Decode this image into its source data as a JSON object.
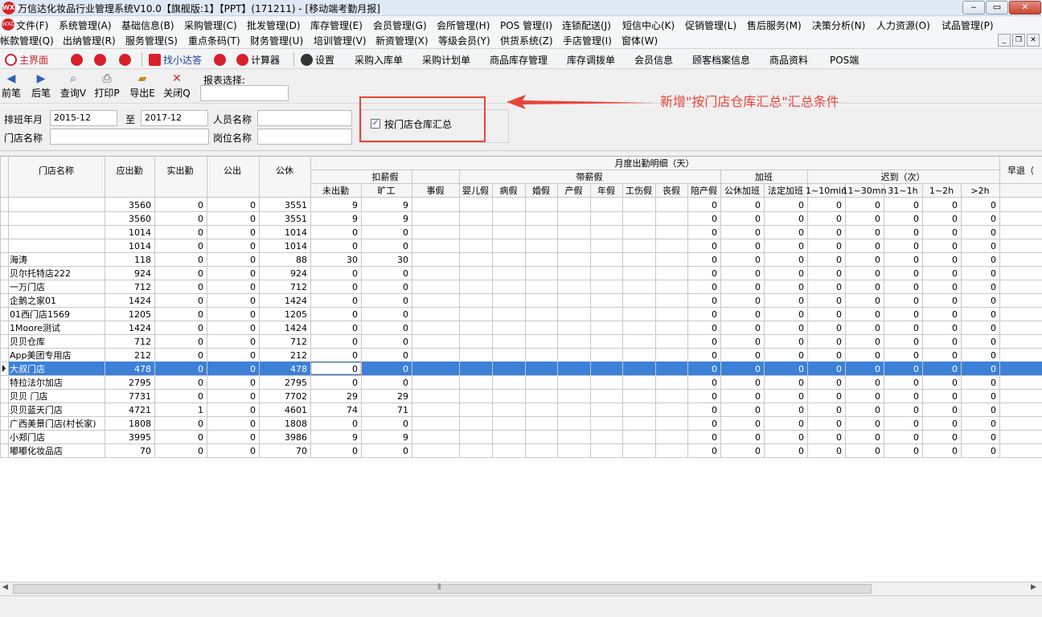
{
  "window": {
    "title": "万信达化妆品行业管理系统V10.0【旗舰版:1】【PPT】(171211) - [移动端考勤月报]",
    "logo_text": "WXD",
    "minimize": "‒",
    "maximize": "▭",
    "close": "✕"
  },
  "menu1": [
    "文件(F)",
    "系统管理(A)",
    "基础信息(B)",
    "采购管理(C)",
    "批发管理(D)",
    "库存管理(E)",
    "会员管理(G)",
    "会所管理(H)",
    "POS 管理(I)",
    "连锁配送(J)",
    "短信中心(K)",
    "促销管理(L)",
    "售后服务(M)",
    "决策分析(N)",
    "人力资源(O)",
    "试品管理(P)"
  ],
  "menu2": [
    "帐款管理(Q)",
    "出纳管理(R)",
    "服务管理(S)",
    "重点条码(T)",
    "财务管理(U)",
    "培训管理(V)",
    "新资管理(X)",
    "等级会员(Y)",
    "供货系统(Z)",
    "手店管理(I)",
    "窗体(W)"
  ],
  "mdi": {
    "minimize": "_",
    "restore": "❐",
    "close": "✕"
  },
  "quickbar": {
    "home": "主界面",
    "find": "找小达答",
    "calc": "计算器",
    "settings": "设置",
    "items": [
      "采购入库单",
      "采购计划单",
      "商品库存管理",
      "库存调拨单",
      "会员信息",
      "顾客档案信息",
      "商品资料",
      "POS端"
    ]
  },
  "toolbar": {
    "prev": "前笔",
    "next": "后笔",
    "query": "查询V",
    "print": "打印P",
    "export": "导出E",
    "close": "关闭Q",
    "report_label": "报表选择:",
    "report_value": ""
  },
  "filter": {
    "period_label": "排班年月",
    "from": "2015-12",
    "to_label": "至",
    "to": "2017-12",
    "person_label": "人员名称",
    "person": "",
    "store_label": "门店名称",
    "store": "",
    "position_label": "岗位名称",
    "position": "",
    "warehouse_check_label": "按门店仓库汇总",
    "warehouse_checked": true
  },
  "annotation": "新增\"按门店仓库汇总\"汇总条件",
  "colors": {
    "accent": "#e8453a",
    "selection": "#3c80d8",
    "title_bg": "#dfe8f5"
  },
  "grid": {
    "h_store": "门店名称",
    "h_due": "应出勤",
    "h_actual": "实出勤",
    "h_out": "公出",
    "h_holiday": "公休",
    "h_detail": "月度出勤明细（天）",
    "h_deduct": "扣薪假",
    "h_paid": "带薪假",
    "h_overtime": "加班",
    "h_late": "迟到（次）",
    "h_early": "早退（",
    "sub": [
      "未出勤",
      "旷工",
      "事假",
      "婴儿假",
      "病假",
      "婚假",
      "产假",
      "年假",
      "工伤假",
      "丧假",
      "陪产假",
      "公休加班",
      "法定加班",
      "1~10min",
      "11~30mn",
      "31~1h",
      "1~2h",
      ">2h"
    ],
    "rows": [
      {
        "name": "",
        "v": [
          "3560",
          "0",
          "0",
          "3551",
          "9",
          "9",
          "",
          "",
          "",
          "",
          "",
          "",
          "",
          "",
          "0",
          "0",
          "0",
          "0",
          "0",
          "0",
          "0",
          "0"
        ]
      },
      {
        "name": "",
        "v": [
          "3560",
          "0",
          "0",
          "3551",
          "9",
          "9",
          "",
          "",
          "",
          "",
          "",
          "",
          "",
          "",
          "0",
          "0",
          "0",
          "0",
          "0",
          "0",
          "0",
          "0"
        ]
      },
      {
        "name": "",
        "v": [
          "1014",
          "0",
          "0",
          "1014",
          "0",
          "0",
          "",
          "",
          "",
          "",
          "",
          "",
          "",
          "",
          "0",
          "0",
          "0",
          "0",
          "0",
          "0",
          "0",
          "0"
        ]
      },
      {
        "name": "",
        "v": [
          "1014",
          "0",
          "0",
          "1014",
          "0",
          "0",
          "",
          "",
          "",
          "",
          "",
          "",
          "",
          "",
          "0",
          "0",
          "0",
          "0",
          "0",
          "0",
          "0",
          "0"
        ]
      },
      {
        "name": "海涛",
        "v": [
          "118",
          "0",
          "0",
          "88",
          "30",
          "30",
          "",
          "",
          "",
          "",
          "",
          "",
          "",
          "",
          "0",
          "0",
          "0",
          "0",
          "0",
          "0",
          "0",
          "0"
        ]
      },
      {
        "name": "贝尔托特店222",
        "v": [
          "924",
          "0",
          "0",
          "924",
          "0",
          "0",
          "",
          "",
          "",
          "",
          "",
          "",
          "",
          "",
          "0",
          "0",
          "0",
          "0",
          "0",
          "0",
          "0",
          "0"
        ]
      },
      {
        "name": "一万门店",
        "v": [
          "712",
          "0",
          "0",
          "712",
          "0",
          "0",
          "",
          "",
          "",
          "",
          "",
          "",
          "",
          "",
          "0",
          "0",
          "0",
          "0",
          "0",
          "0",
          "0",
          "0"
        ]
      },
      {
        "name": "企鹅之家01",
        "v": [
          "1424",
          "0",
          "0",
          "1424",
          "0",
          "0",
          "",
          "",
          "",
          "",
          "",
          "",
          "",
          "",
          "0",
          "0",
          "0",
          "0",
          "0",
          "0",
          "0",
          "0"
        ]
      },
      {
        "name": "01西门店1569",
        "v": [
          "1205",
          "0",
          "0",
          "1205",
          "0",
          "0",
          "",
          "",
          "",
          "",
          "",
          "",
          "",
          "",
          "0",
          "0",
          "0",
          "0",
          "0",
          "0",
          "0",
          "0"
        ]
      },
      {
        "name": "1Moore测试",
        "v": [
          "1424",
          "0",
          "0",
          "1424",
          "0",
          "0",
          "",
          "",
          "",
          "",
          "",
          "",
          "",
          "",
          "0",
          "0",
          "0",
          "0",
          "0",
          "0",
          "0",
          "0"
        ]
      },
      {
        "name": "贝贝仓库",
        "v": [
          "712",
          "0",
          "0",
          "712",
          "0",
          "0",
          "",
          "",
          "",
          "",
          "",
          "",
          "",
          "",
          "0",
          "0",
          "0",
          "0",
          "0",
          "0",
          "0",
          "0"
        ]
      },
      {
        "name": "App美团专用店",
        "v": [
          "212",
          "0",
          "0",
          "212",
          "0",
          "0",
          "",
          "",
          "",
          "",
          "",
          "",
          "",
          "",
          "0",
          "0",
          "0",
          "0",
          "0",
          "0",
          "0",
          "0"
        ]
      },
      {
        "name": "大叔门店",
        "v": [
          "478",
          "0",
          "0",
          "478",
          "0",
          "0",
          "",
          "",
          "",
          "",
          "",
          "",
          "",
          "",
          "0",
          "0",
          "0",
          "0",
          "0",
          "0",
          "0",
          "0"
        ],
        "selected": true
      },
      {
        "name": "特拉法尔加店",
        "v": [
          "2795",
          "0",
          "0",
          "2795",
          "0",
          "0",
          "",
          "",
          "",
          "",
          "",
          "",
          "",
          "",
          "0",
          "0",
          "0",
          "0",
          "0",
          "0",
          "0",
          "0"
        ]
      },
      {
        "name": "贝贝 门店",
        "v": [
          "7731",
          "0",
          "0",
          "7702",
          "29",
          "29",
          "",
          "",
          "",
          "",
          "",
          "",
          "",
          "",
          "0",
          "0",
          "0",
          "0",
          "0",
          "0",
          "0",
          "0"
        ]
      },
      {
        "name": "贝贝蓝天门店",
        "v": [
          "4721",
          "1",
          "0",
          "4601",
          "74",
          "71",
          "",
          "",
          "",
          "",
          "",
          "",
          "",
          "",
          "0",
          "0",
          "0",
          "0",
          "0",
          "0",
          "0",
          "0"
        ]
      },
      {
        "name": "广西美景门店(村长家)",
        "v": [
          "1808",
          "0",
          "0",
          "1808",
          "0",
          "0",
          "",
          "",
          "",
          "",
          "",
          "",
          "",
          "",
          "0",
          "0",
          "0",
          "0",
          "0",
          "0",
          "0",
          "0"
        ]
      },
      {
        "name": "小郑门店",
        "v": [
          "3995",
          "0",
          "0",
          "3986",
          "9",
          "9",
          "",
          "",
          "",
          "",
          "",
          "",
          "",
          "",
          "0",
          "0",
          "0",
          "0",
          "0",
          "0",
          "0",
          "0"
        ]
      },
      {
        "name": "嘟嘟化妆品店",
        "v": [
          "70",
          "0",
          "0",
          "70",
          "0",
          "0",
          "",
          "",
          "",
          "",
          "",
          "",
          "",
          "",
          "0",
          "0",
          "0",
          "0",
          "0",
          "0",
          "0",
          "0"
        ]
      }
    ]
  },
  "scroll": {
    "left": "◀",
    "right": "▶",
    "grip": "⦀"
  }
}
